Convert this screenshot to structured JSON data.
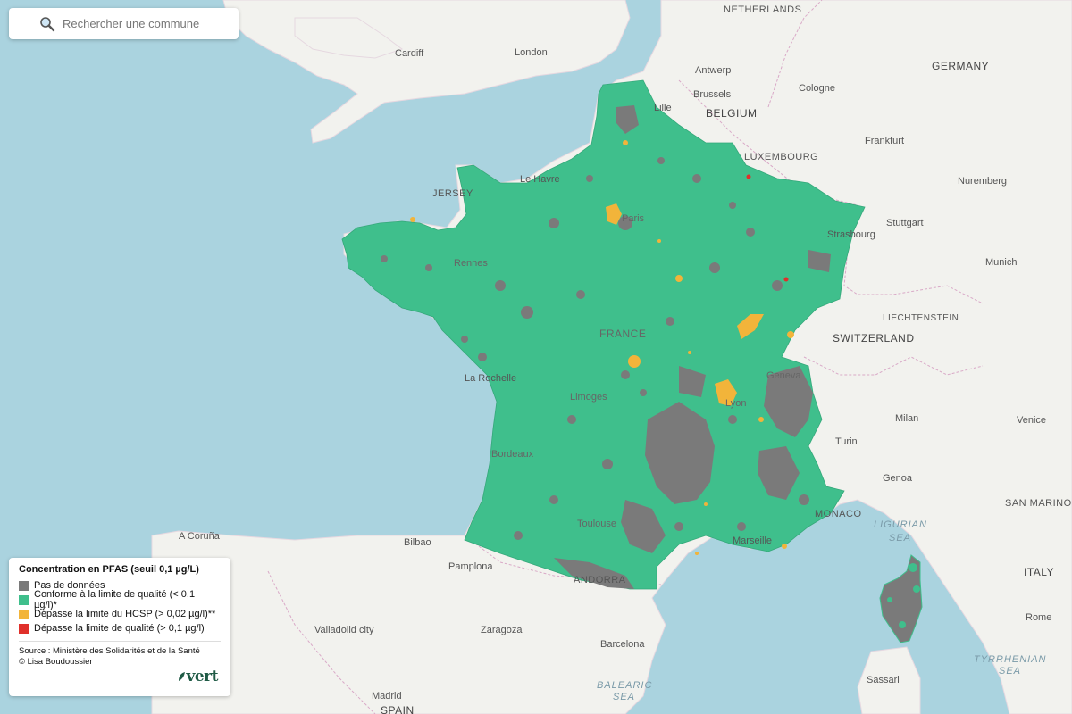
{
  "search": {
    "placeholder": "Rechercher une commune",
    "icon": "magnifier-icon"
  },
  "legend": {
    "title": "Concentration en PFAS (seuil 0,1 µg/L)",
    "items": [
      {
        "label": "Pas de données",
        "color": "#7a7a7a"
      },
      {
        "label": "Conforme à la limite de qualité (< 0,1 µg/l)*",
        "color": "#3fbf8c"
      },
      {
        "label": "Dépasse la limite du HCSP (> 0,02 µg/l)**",
        "color": "#f2b43a"
      },
      {
        "label": "Dépasse la limite de qualité (> 0,1 µg/l)",
        "color": "#e0302b"
      }
    ],
    "source_line1": "Source : Ministère des Solidarités et de la Santé",
    "source_line2": "© Lisa Boudoussier",
    "logo_text": "vert"
  },
  "colors": {
    "sea": "#aad3df",
    "land": "#f2f2ee",
    "land_alt": "#ecebe4",
    "border": "#d9a9c7",
    "compliant": "#3fbf8c",
    "no_data": "#7a7a7a",
    "hcsp": "#f2b43a",
    "exceed": "#e0302b"
  },
  "map_labels": {
    "netherlands": "NETHERLANDS",
    "cardiff": "Cardiff",
    "london": "London",
    "antwerp": "Antwerp",
    "brussels": "Brussels",
    "belgium": "BELGIUM",
    "cologne": "Cologne",
    "germany": "GERMANY",
    "lille": "Lille",
    "luxembourg": "LUXEMBOURG",
    "frankfurt": "Frankfurt",
    "nuremberg": "Nuremberg",
    "le_havre": "Le Havre",
    "jersey": "JERSEY",
    "paris": "Paris",
    "stuttgart": "Stuttgart",
    "strasbourg": "Strasbourg",
    "munich": "Munich",
    "rennes": "Rennes",
    "liechtenstein": "LIECHTENSTEIN",
    "switzerland": "SWITZERLAND",
    "france": "FRANCE",
    "la_rochelle": "La Rochelle",
    "geneva": "Geneva",
    "limoges": "Limoges",
    "lyon": "Lyon",
    "milan": "Milan",
    "venice": "Venice",
    "turin": "Turin",
    "bordeaux": "Bordeaux",
    "genoa": "Genoa",
    "san_marino": "SAN MARINO",
    "monaco": "MONACO",
    "toulouse": "Toulouse",
    "ligurian": "LIGURIAN",
    "sea1": "SEA",
    "a_coruna": "A Coruña",
    "bilbao": "Bilbao",
    "marseille": "Marseille",
    "pamplona": "Pamplona",
    "italy": "ITALY",
    "andorra": "ANDORRA",
    "rome": "Rome",
    "valladolid": "Valladolid city",
    "zaragoza": "Zaragoza",
    "barcelona": "Barcelona",
    "tyrrhenian": "TYRRHENIAN",
    "sea2": "SEA",
    "balearic": "BALEARIC",
    "sea3": "SEA",
    "madrid": "Madrid",
    "spain": "SPAIN",
    "sassari": "Sassari"
  }
}
